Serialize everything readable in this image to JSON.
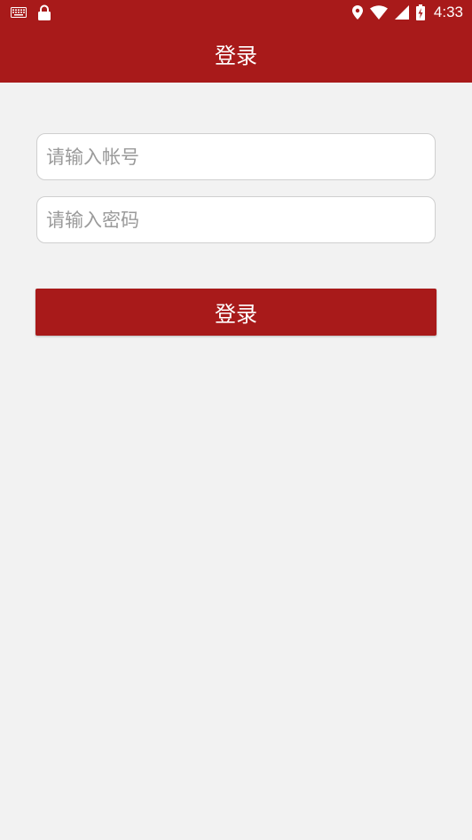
{
  "status_bar": {
    "time": "4:33",
    "icons": [
      "keyboard-icon",
      "lock-icon",
      "location-icon",
      "wifi-icon",
      "signal-icon",
      "battery-charging-icon"
    ]
  },
  "app_bar": {
    "title": "登录"
  },
  "form": {
    "account_placeholder": "请输入帐号",
    "account_value": "",
    "password_placeholder": "请输入密码",
    "password_value": "",
    "login_label": "登录"
  },
  "colors": {
    "primary": "#a81a1a",
    "background": "#f2f2f2",
    "field_border": "#cfcfcf",
    "placeholder": "#9a9a9a"
  }
}
